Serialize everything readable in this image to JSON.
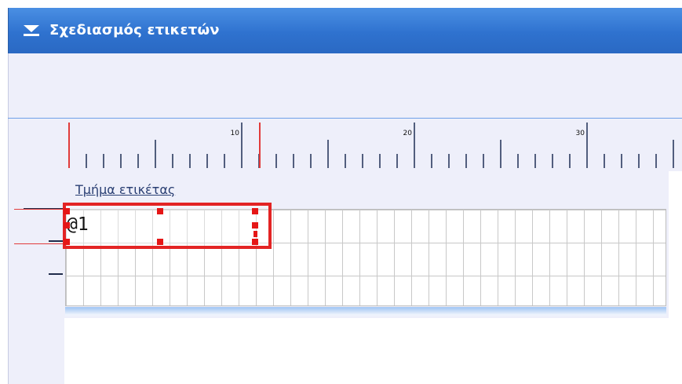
{
  "title_bar": {
    "title": "Σχεδιασμός ετικετών",
    "collapse_icon": "chevron-double-down-icon"
  },
  "ruler": {
    "labels": [
      "10",
      "20",
      "30"
    ],
    "accent_color": "#e13b3b"
  },
  "section": {
    "label": "Τμήμα ετικέτας"
  },
  "field": {
    "value": "@1",
    "selected": true
  },
  "colors": {
    "title_bar": "#2f72cf",
    "panel": "#eeeffa",
    "selection": "#e32424"
  }
}
